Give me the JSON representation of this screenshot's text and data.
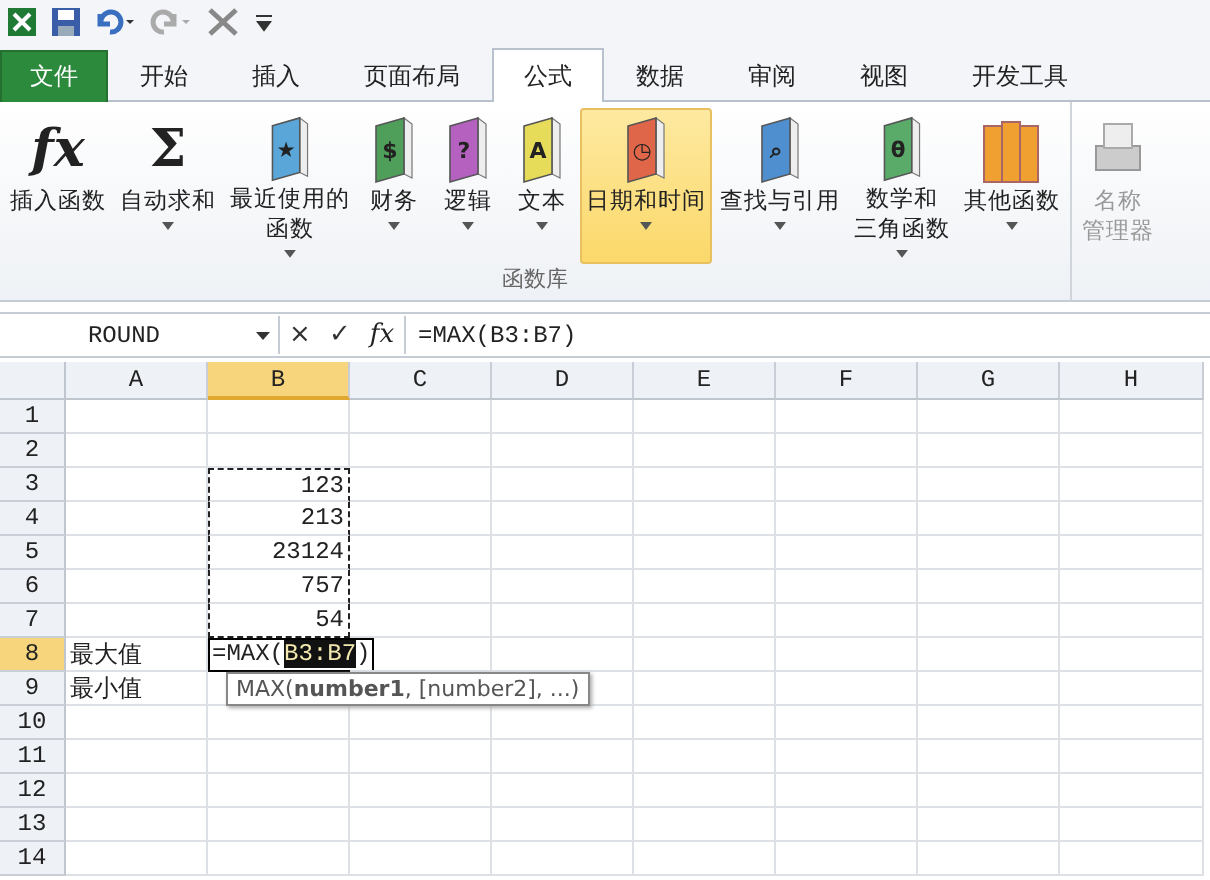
{
  "quick_access": {
    "items": [
      {
        "kind": "excel"
      },
      {
        "kind": "save"
      },
      {
        "kind": "undo"
      },
      {
        "kind": "redo"
      },
      {
        "kind": "tools"
      },
      {
        "kind": "customize"
      }
    ]
  },
  "tabs": [
    {
      "label": "文件",
      "kind": "file",
      "selected": false
    },
    {
      "label": "开始",
      "kind": "tab",
      "selected": false
    },
    {
      "label": "插入",
      "kind": "tab",
      "selected": false
    },
    {
      "label": "页面布局",
      "kind": "tab",
      "selected": false
    },
    {
      "label": "公式",
      "kind": "tab",
      "selected": true
    },
    {
      "label": "数据",
      "kind": "tab",
      "selected": false
    },
    {
      "label": "审阅",
      "kind": "tab",
      "selected": false
    },
    {
      "label": "视图",
      "kind": "tab",
      "selected": false
    },
    {
      "label": "开发工具",
      "kind": "tab",
      "selected": false
    }
  ],
  "ribbon": {
    "group_label": "函数库",
    "buttons": [
      {
        "kind": "symbol",
        "glyph": "fx",
        "lines": [
          "插入函数"
        ],
        "dropdown": false,
        "selected": false
      },
      {
        "kind": "symbol",
        "glyph": "Σ",
        "lines": [
          "自动求和"
        ],
        "dropdown": true,
        "selected": false
      },
      {
        "kind": "book",
        "glyph": "★",
        "color": "#5aa6d8",
        "lines": [
          "最近使用的",
          "函数"
        ],
        "dropdown": true,
        "selected": false
      },
      {
        "kind": "book",
        "glyph": "$",
        "color": "#4f9e5a",
        "lines": [
          "财务"
        ],
        "dropdown": true,
        "selected": false
      },
      {
        "kind": "book",
        "glyph": "?",
        "color": "#b561c0",
        "lines": [
          "逻辑"
        ],
        "dropdown": true,
        "selected": false
      },
      {
        "kind": "book",
        "glyph": "A",
        "color": "#e6dc5a",
        "lines": [
          "文本"
        ],
        "dropdown": true,
        "selected": false
      },
      {
        "kind": "book",
        "glyph": "◷",
        "color": "#e0664a",
        "lines": [
          "日期和时间"
        ],
        "dropdown": true,
        "selected": true
      },
      {
        "kind": "book",
        "glyph": "⌕",
        "color": "#4f8fcf",
        "lines": [
          "查找与引用"
        ],
        "dropdown": true,
        "selected": false
      },
      {
        "kind": "book",
        "glyph": "θ",
        "color": "#5aaa6a",
        "lines": [
          "数学和",
          "三角函数"
        ],
        "dropdown": true,
        "selected": false
      },
      {
        "kind": "books",
        "color": "#f0a030",
        "lines": [
          "其他函数"
        ],
        "dropdown": true,
        "selected": false
      }
    ],
    "extra_buttons": [
      {
        "kind": "printer",
        "lines": [
          "名称",
          "管理器"
        ],
        "disabled": true
      }
    ]
  },
  "formula_bar": {
    "name_box": "ROUND",
    "cancel": "×",
    "enter": "✓",
    "function": "fx",
    "formula": "=MAX(B3:B7)"
  },
  "sheet": {
    "columns": [
      {
        "label": "A",
        "selected": false
      },
      {
        "label": "B",
        "selected": true
      },
      {
        "label": "C",
        "selected": false
      },
      {
        "label": "D",
        "selected": false
      },
      {
        "label": "E",
        "selected": false
      },
      {
        "label": "F",
        "selected": false
      },
      {
        "label": "G",
        "selected": false
      },
      {
        "label": "H",
        "selected": false
      }
    ],
    "rows": [
      {
        "label": "1",
        "selected": false,
        "cells": []
      },
      {
        "label": "2",
        "selected": false,
        "cells": []
      },
      {
        "label": "3",
        "selected": false,
        "cells": [
          {
            "kind": "empty"
          },
          {
            "kind": "number",
            "text": "123",
            "copied": true
          }
        ]
      },
      {
        "label": "4",
        "selected": false,
        "cells": [
          {
            "kind": "empty"
          },
          {
            "kind": "number",
            "text": "213",
            "copied": true
          }
        ]
      },
      {
        "label": "5",
        "selected": false,
        "cells": [
          {
            "kind": "empty"
          },
          {
            "kind": "number",
            "text": "23124",
            "copied": true
          }
        ]
      },
      {
        "label": "6",
        "selected": false,
        "cells": [
          {
            "kind": "empty"
          },
          {
            "kind": "number",
            "text": "757",
            "copied": true
          }
        ]
      },
      {
        "label": "7",
        "selected": false,
        "cells": [
          {
            "kind": "empty"
          },
          {
            "kind": "number",
            "text": "54",
            "copied": true
          }
        ]
      },
      {
        "label": "8",
        "selected": true,
        "cells": [
          {
            "kind": "text",
            "text": "最大值",
            "copied": false
          },
          {
            "kind": "editing",
            "prefix": "=MAX(",
            "reference": "B3:B7",
            "suffix": ")",
            "copied": false,
            "tooltip": "MAX(**number1**, [number2], ...)"
          }
        ]
      },
      {
        "label": "9",
        "selected": false,
        "cells": [
          {
            "kind": "text",
            "text": "最小值",
            "copied": false
          }
        ]
      },
      {
        "label": "10",
        "selected": false,
        "cells": []
      },
      {
        "label": "11",
        "selected": false,
        "cells": []
      },
      {
        "label": "12",
        "selected": false,
        "cells": []
      },
      {
        "label": "13",
        "selected": false,
        "cells": []
      },
      {
        "label": "14",
        "selected": false,
        "cells": []
      }
    ]
  }
}
